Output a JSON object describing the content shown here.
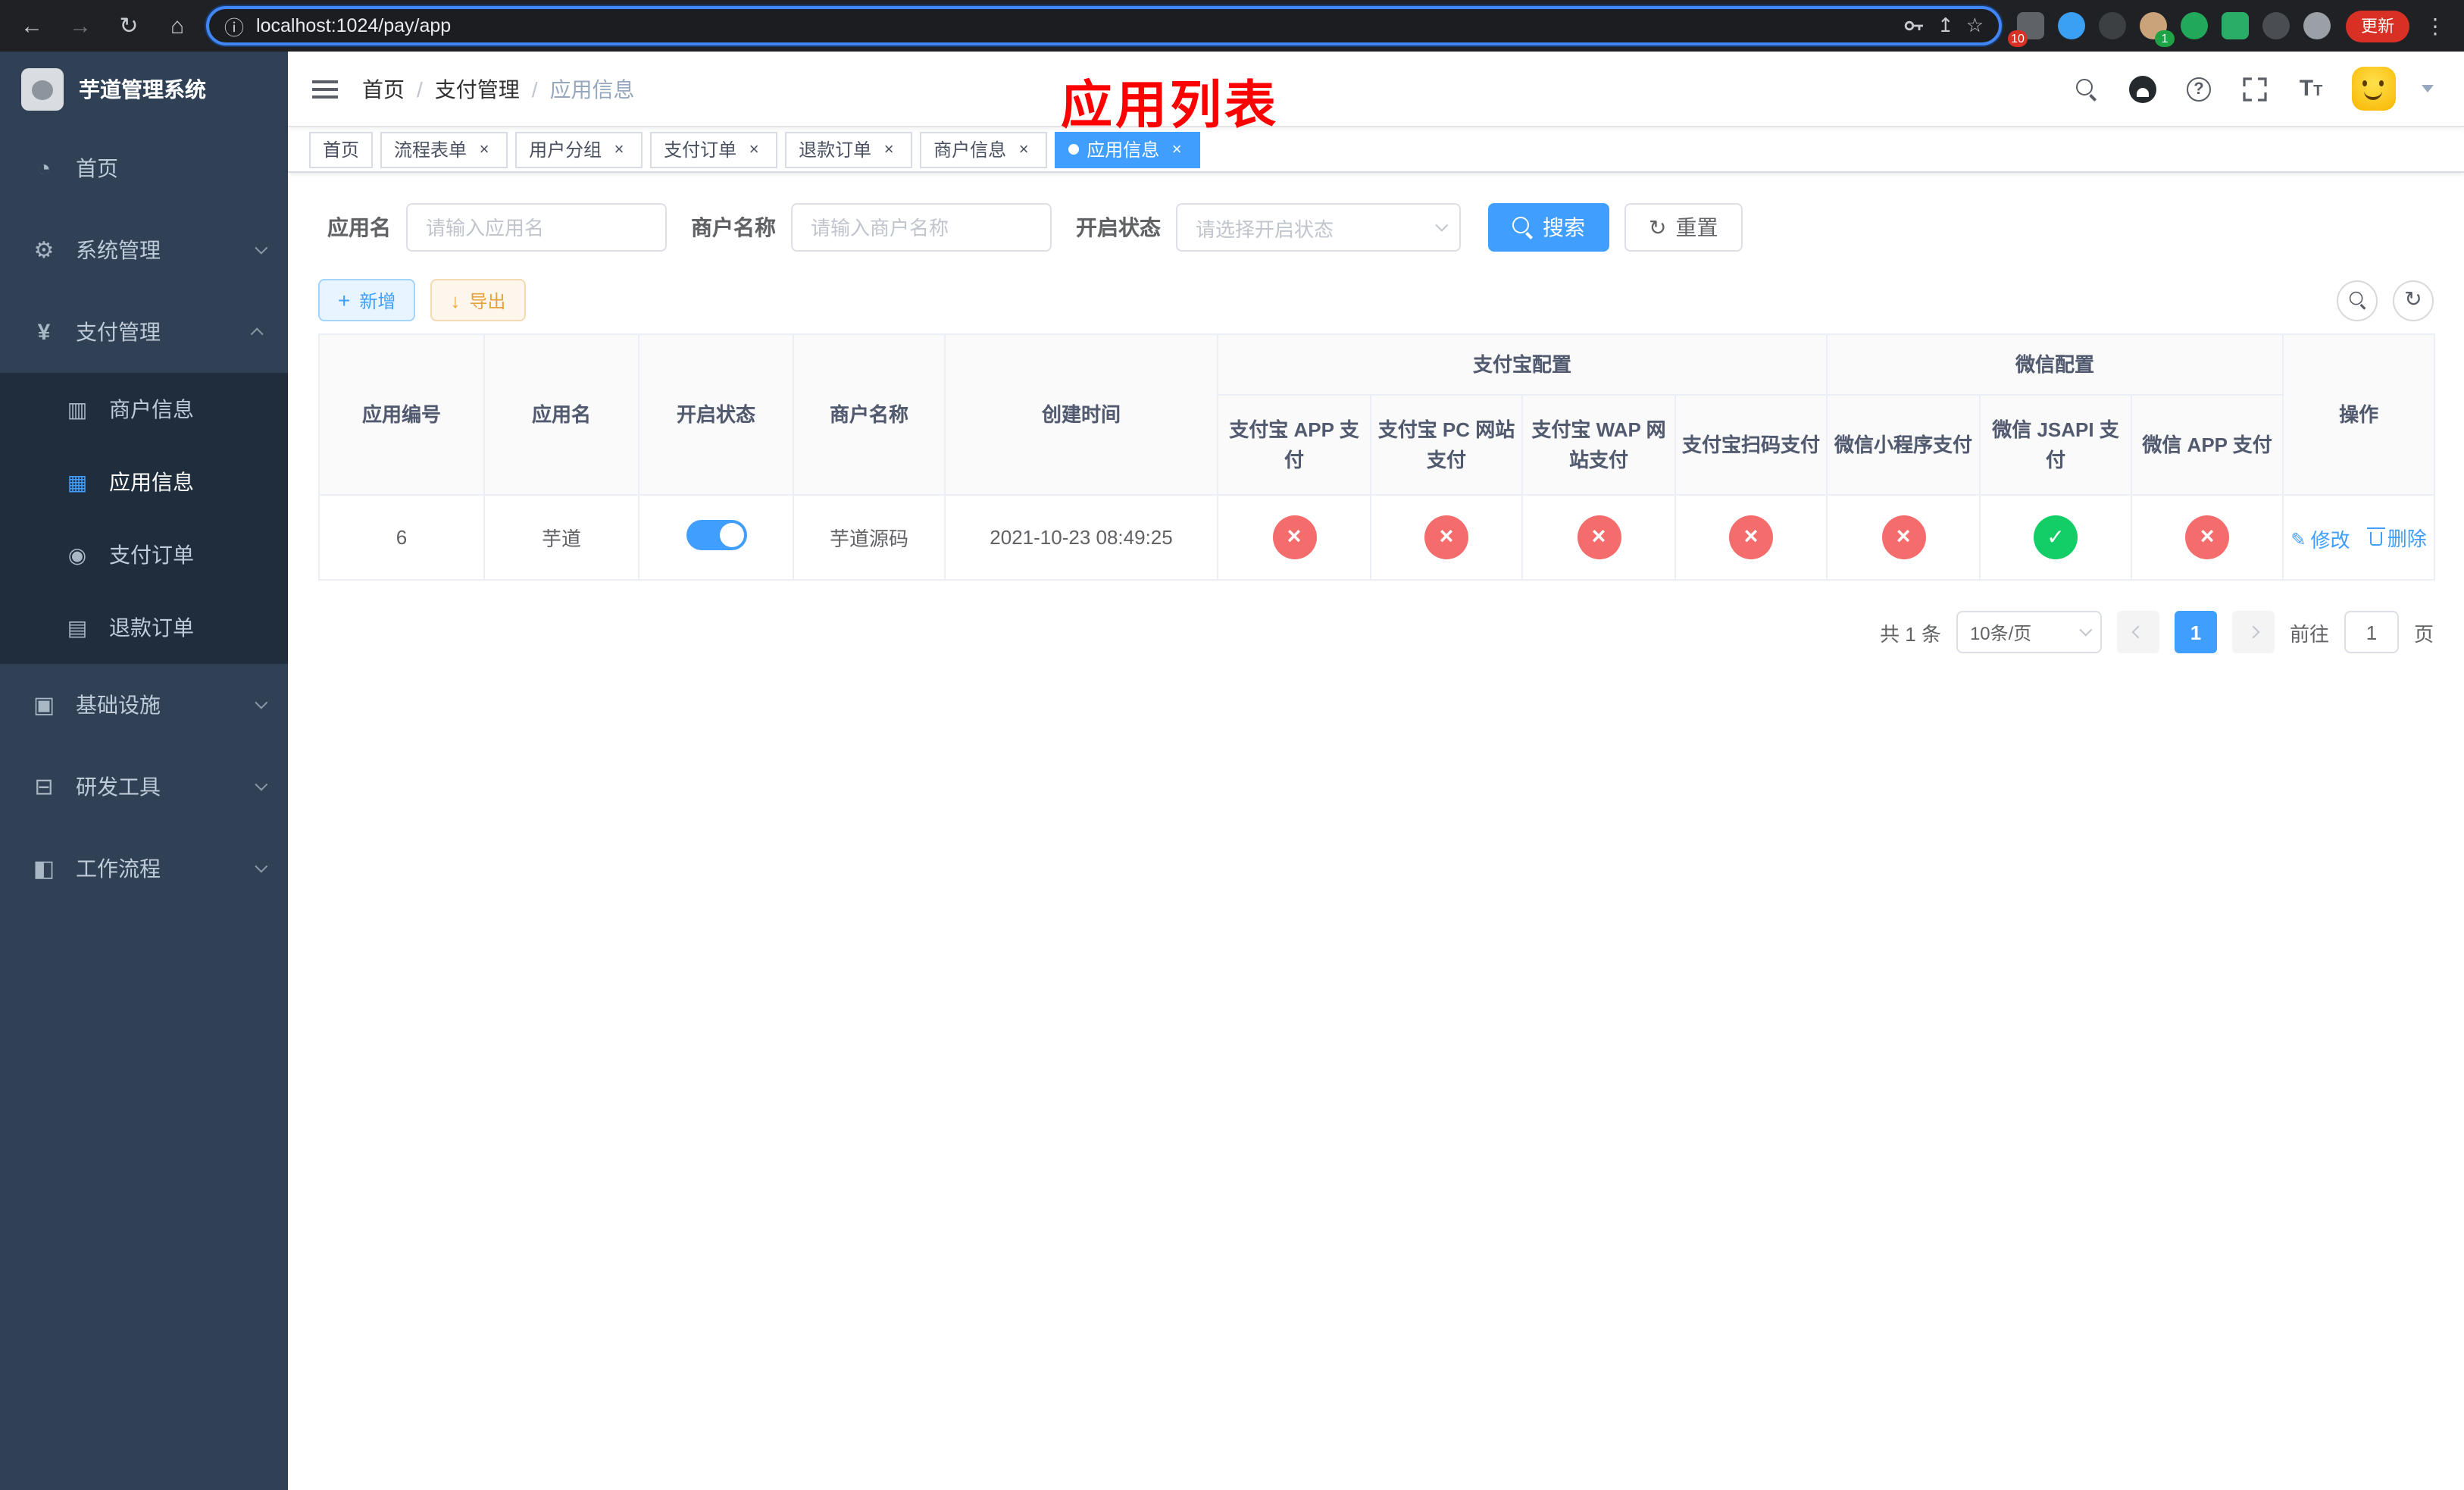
{
  "browser": {
    "url": "localhost:1024/pay/app",
    "update_label": "更新",
    "extension_badge_1": "10",
    "extension_badge_2": "1"
  },
  "sidebar": {
    "title": "芋道管理系统",
    "items": [
      {
        "label": "首页"
      },
      {
        "label": "系统管理"
      },
      {
        "label": "支付管理"
      },
      {
        "label": "基础设施"
      },
      {
        "label": "研发工具"
      },
      {
        "label": "工作流程"
      }
    ],
    "submenu": [
      {
        "label": "商户信息"
      },
      {
        "label": "应用信息",
        "active": true
      },
      {
        "label": "支付订单"
      },
      {
        "label": "退款订单"
      }
    ]
  },
  "navbar": {
    "breadcrumb": [
      "首页",
      "支付管理",
      "应用信息"
    ]
  },
  "annotation": {
    "text": "应用列表",
    "color": "#ff0000"
  },
  "tabs": [
    {
      "label": "首页",
      "closable": false,
      "active": false
    },
    {
      "label": "流程表单",
      "closable": true,
      "active": false
    },
    {
      "label": "用户分组",
      "closable": true,
      "active": false
    },
    {
      "label": "支付订单",
      "closable": true,
      "active": false
    },
    {
      "label": "退款订单",
      "closable": true,
      "active": false
    },
    {
      "label": "商户信息",
      "closable": true,
      "active": false
    },
    {
      "label": "应用信息",
      "closable": true,
      "active": true
    }
  ],
  "filters": {
    "app_name_label": "应用名",
    "app_name_placeholder": "请输入应用名",
    "merchant_label": "商户名称",
    "merchant_placeholder": "请输入商户名称",
    "status_label": "开启状态",
    "status_placeholder": "请选择开启状态",
    "search_label": "搜索",
    "reset_label": "重置"
  },
  "toolbar": {
    "add_label": "新增",
    "export_label": "导出"
  },
  "table": {
    "col_id": "应用编号",
    "col_name": "应用名",
    "col_status": "开启状态",
    "col_merchant": "商户名称",
    "col_created": "创建时间",
    "group_alipay": "支付宝配置",
    "group_wechat": "微信配置",
    "alipay_cols": [
      "支付宝 APP 支付",
      "支付宝 PC 网站支付",
      "支付宝 WAP 网站支付",
      "支付宝扫码支付"
    ],
    "wechat_cols": [
      "微信小程序支付",
      "微信 JSAPI 支付",
      "微信 APP 支付"
    ],
    "col_ops": "操作",
    "row": {
      "id": "6",
      "name": "芋道",
      "enabled": true,
      "merchant": "芋道源码",
      "created": "2021-10-23 08:49:25",
      "configs": [
        "no",
        "no",
        "no",
        "no",
        "no",
        "yes",
        "no"
      ],
      "edit_label": "修改",
      "delete_label": "删除"
    }
  },
  "pagination": {
    "total": "共 1 条",
    "page_size": "10条/页",
    "page": "1",
    "goto_label": "前往",
    "goto_value": "1",
    "goto_unit": "页"
  },
  "colors": {
    "accent": "#409eff",
    "danger": "#f56c6c",
    "success": "#13ce66",
    "warning": "#e6a23c",
    "sidebar_bg": "#304156",
    "submenu_bg": "#1f2d3d",
    "annotation_red": "#ff0000"
  }
}
